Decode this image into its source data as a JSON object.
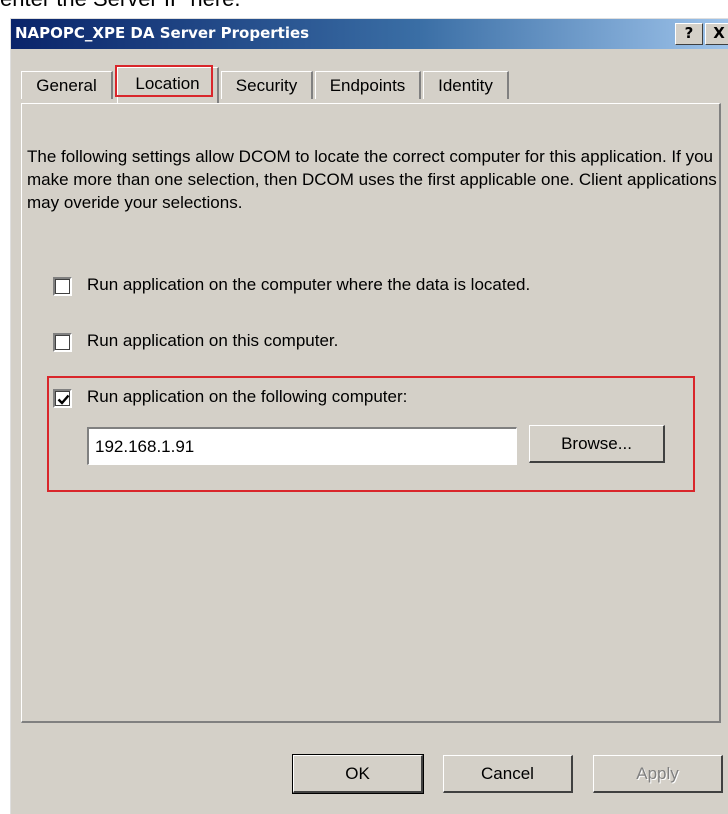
{
  "caption": "enter the Server IP here.",
  "window": {
    "title": "NAPOPC_XPE DA Server Properties",
    "help_label": "?",
    "close_label": "X"
  },
  "tabs": [
    {
      "label": "General",
      "active": false
    },
    {
      "label": "Location",
      "active": true
    },
    {
      "label": "Security",
      "active": false
    },
    {
      "label": "Endpoints",
      "active": false
    },
    {
      "label": "Identity",
      "active": false
    }
  ],
  "description": "The following settings allow DCOM to locate the correct computer for this application. If you make more than one selection, then DCOM uses the first applicable one. Client applications may overide your selections.",
  "options": [
    {
      "label": "Run application on the computer where the data is located.",
      "checked": false
    },
    {
      "label": "Run application on this computer.",
      "checked": false
    },
    {
      "label": "Run application on the following computer:",
      "checked": true
    }
  ],
  "server": {
    "value": "192.168.1.91",
    "browse_label": "Browse..."
  },
  "buttons": {
    "ok": "OK",
    "cancel": "Cancel",
    "apply": "Apply"
  },
  "colors": {
    "highlight": "#d9262b",
    "dialog_bg": "#d4d0c8",
    "titlebar": "#0a246a"
  }
}
